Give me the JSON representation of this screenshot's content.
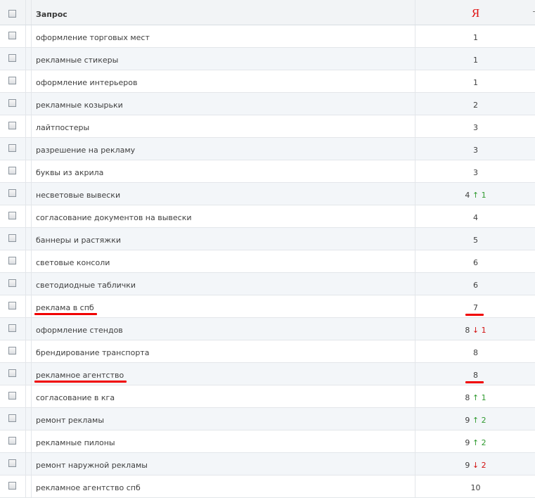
{
  "header": {
    "query_label": "Запрос",
    "engine_logo": "Я",
    "engine_logo_color": "#e01010"
  },
  "colors": {
    "up": "#2f9a2f",
    "down": "#d21010",
    "highlight_underline": "#f00000"
  },
  "rows": [
    {
      "query": "оформление торговых мест",
      "pos": "1"
    },
    {
      "query": "рекламные стикеры",
      "pos": "1"
    },
    {
      "query": "оформление интерьеров",
      "pos": "1"
    },
    {
      "query": "рекламные козырьки",
      "pos": "2"
    },
    {
      "query": "лайтпостеры",
      "pos": "3"
    },
    {
      "query": "разрешение на рекламу",
      "pos": "3"
    },
    {
      "query": "буквы из акрила",
      "pos": "3"
    },
    {
      "query": "несветовые вывески",
      "pos": "4",
      "arrow": "↑",
      "dir": "up",
      "delta": "1"
    },
    {
      "query": "согласование документов на вывески",
      "pos": "4"
    },
    {
      "query": "баннеры и растяжки",
      "pos": "5"
    },
    {
      "query": "световые консоли",
      "pos": "6"
    },
    {
      "query": "светодиодные таблички",
      "pos": "6"
    },
    {
      "query": "реклама в спб",
      "pos": "7",
      "highlighted": true
    },
    {
      "query": "оформление стендов",
      "pos": "8",
      "arrow": "↓",
      "dir": "down",
      "delta": "1"
    },
    {
      "query": "брендирование транспорта",
      "pos": "8"
    },
    {
      "query": "рекламное агентство",
      "pos": "8",
      "highlighted": true
    },
    {
      "query": "согласование в кга",
      "pos": "8",
      "arrow": "↑",
      "dir": "up",
      "delta": "1"
    },
    {
      "query": "ремонт рекламы",
      "pos": "9",
      "arrow": "↑",
      "dir": "up",
      "delta": "2"
    },
    {
      "query": "рекламные пилоны",
      "pos": "9",
      "arrow": "↑",
      "dir": "up",
      "delta": "2"
    },
    {
      "query": "ремонт наружной рекламы",
      "pos": "9",
      "arrow": "↓",
      "dir": "down",
      "delta": "2"
    },
    {
      "query": "рекламное агентство спб",
      "pos": "10"
    }
  ]
}
